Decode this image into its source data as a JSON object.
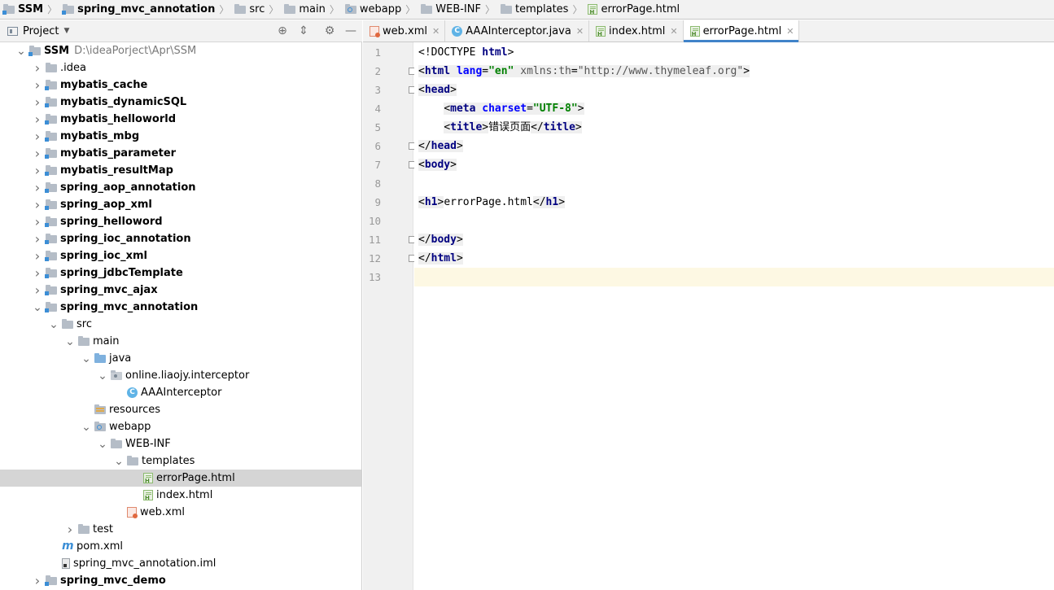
{
  "breadcrumb": [
    {
      "label": "SSM",
      "icon": "module-folder-icon",
      "bold": true
    },
    {
      "label": "spring_mvc_annotation",
      "icon": "module-folder-icon",
      "bold": true
    },
    {
      "label": "src",
      "icon": "folder-icon"
    },
    {
      "label": "main",
      "icon": "folder-icon"
    },
    {
      "label": "webapp",
      "icon": "web-folder-icon"
    },
    {
      "label": "WEB-INF",
      "icon": "folder-icon"
    },
    {
      "label": "templates",
      "icon": "folder-icon"
    },
    {
      "label": "errorPage.html",
      "icon": "html-file-icon"
    }
  ],
  "project_panel": {
    "title": "Project",
    "tree": [
      {
        "depth": 0,
        "arrow": "down",
        "icon": "module-folder-icon",
        "label": "SSM",
        "bold": true,
        "path": "D:\\ideaPorject\\Apr\\SSM"
      },
      {
        "depth": 1,
        "arrow": "right",
        "icon": "folder-icon",
        "label": ".idea"
      },
      {
        "depth": 1,
        "arrow": "right",
        "icon": "module-folder-icon",
        "label": "mybatis_cache",
        "bold": true
      },
      {
        "depth": 1,
        "arrow": "right",
        "icon": "module-folder-icon",
        "label": "mybatis_dynamicSQL",
        "bold": true
      },
      {
        "depth": 1,
        "arrow": "right",
        "icon": "module-folder-icon",
        "label": "mybatis_helloworld",
        "bold": true
      },
      {
        "depth": 1,
        "arrow": "right",
        "icon": "module-folder-icon",
        "label": "mybatis_mbg",
        "bold": true
      },
      {
        "depth": 1,
        "arrow": "right",
        "icon": "module-folder-icon",
        "label": "mybatis_parameter",
        "bold": true
      },
      {
        "depth": 1,
        "arrow": "right",
        "icon": "module-folder-icon",
        "label": "mybatis_resultMap",
        "bold": true
      },
      {
        "depth": 1,
        "arrow": "right",
        "icon": "module-folder-icon",
        "label": "spring_aop_annotation",
        "bold": true
      },
      {
        "depth": 1,
        "arrow": "right",
        "icon": "module-folder-icon",
        "label": "spring_aop_xml",
        "bold": true
      },
      {
        "depth": 1,
        "arrow": "right",
        "icon": "module-folder-icon",
        "label": "spring_helloword",
        "bold": true
      },
      {
        "depth": 1,
        "arrow": "right",
        "icon": "module-folder-icon",
        "label": "spring_ioc_annotation",
        "bold": true
      },
      {
        "depth": 1,
        "arrow": "right",
        "icon": "module-folder-icon",
        "label": "spring_ioc_xml",
        "bold": true
      },
      {
        "depth": 1,
        "arrow": "right",
        "icon": "module-folder-icon",
        "label": "spring_jdbcTemplate",
        "bold": true
      },
      {
        "depth": 1,
        "arrow": "right",
        "icon": "module-folder-icon",
        "label": "spring_mvc_ajax",
        "bold": true
      },
      {
        "depth": 1,
        "arrow": "down",
        "icon": "module-folder-icon",
        "label": "spring_mvc_annotation",
        "bold": true
      },
      {
        "depth": 2,
        "arrow": "down",
        "icon": "folder-icon",
        "label": "src"
      },
      {
        "depth": 3,
        "arrow": "down",
        "icon": "folder-icon",
        "label": "main"
      },
      {
        "depth": 4,
        "arrow": "down",
        "icon": "source-folder-icon",
        "label": "java"
      },
      {
        "depth": 5,
        "arrow": "down",
        "icon": "package-icon",
        "label": "online.liaojy.interceptor"
      },
      {
        "depth": 6,
        "arrow": "none",
        "icon": "class-icon",
        "label": "AAAInterceptor"
      },
      {
        "depth": 4,
        "arrow": "none",
        "icon": "resources-folder-icon",
        "label": "resources"
      },
      {
        "depth": 4,
        "arrow": "down",
        "icon": "web-folder-icon",
        "label": "webapp"
      },
      {
        "depth": 5,
        "arrow": "down",
        "icon": "folder-icon",
        "label": "WEB-INF"
      },
      {
        "depth": 6,
        "arrow": "down",
        "icon": "folder-icon",
        "label": "templates"
      },
      {
        "depth": 7,
        "arrow": "none",
        "icon": "html-file-icon",
        "label": "errorPage.html",
        "selected": true
      },
      {
        "depth": 7,
        "arrow": "none",
        "icon": "html-file-icon",
        "label": "index.html"
      },
      {
        "depth": 6,
        "arrow": "none",
        "icon": "xml-file-icon",
        "label": "web.xml"
      },
      {
        "depth": 3,
        "arrow": "right",
        "icon": "folder-icon",
        "label": "test"
      },
      {
        "depth": 2,
        "arrow": "none",
        "icon": "maven-icon",
        "label": "pom.xml"
      },
      {
        "depth": 2,
        "arrow": "none",
        "icon": "iml-file-icon",
        "label": "spring_mvc_annotation.iml"
      },
      {
        "depth": 1,
        "arrow": "right",
        "icon": "module-folder-icon",
        "label": "spring_mvc_demo",
        "bold": true
      }
    ]
  },
  "tabs": [
    {
      "label": "web.xml",
      "icon": "xml-file-icon"
    },
    {
      "label": "AAAInterceptor.java",
      "icon": "class-icon"
    },
    {
      "label": "index.html",
      "icon": "html-file-icon"
    },
    {
      "label": "errorPage.html",
      "icon": "html-file-icon",
      "active": true
    }
  ],
  "editor": {
    "current_line": 13,
    "lines": [
      [
        {
          "t": "<!DOCTYPE ",
          "c": ""
        },
        {
          "t": "html",
          "c": "tg"
        },
        {
          "t": ">",
          "c": ""
        }
      ],
      [
        {
          "t": "<",
          "c": "hl"
        },
        {
          "t": "html",
          "c": "tg hl"
        },
        {
          "t": " ",
          "c": "hl"
        },
        {
          "t": "lang",
          "c": "at hl"
        },
        {
          "t": "=",
          "c": "hl"
        },
        {
          "t": "\"en\"",
          "c": "st hl"
        },
        {
          "t": " ",
          "c": "hl"
        },
        {
          "t": "xmlns:th",
          "c": "gr hl"
        },
        {
          "t": "=",
          "c": "hl"
        },
        {
          "t": "\"http://www.thymeleaf.org\"",
          "c": "gr hl"
        },
        {
          "t": ">",
          "c": "hl"
        }
      ],
      [
        {
          "t": "<",
          "c": "hl"
        },
        {
          "t": "head",
          "c": "tg hl"
        },
        {
          "t": ">",
          "c": "hl"
        }
      ],
      [
        {
          "t": "    ",
          "c": ""
        },
        {
          "t": "<",
          "c": "hl"
        },
        {
          "t": "meta",
          "c": "tg hl"
        },
        {
          "t": " ",
          "c": "hl"
        },
        {
          "t": "charset",
          "c": "at hl"
        },
        {
          "t": "=",
          "c": "hl"
        },
        {
          "t": "\"UTF-8\"",
          "c": "st hl"
        },
        {
          "t": ">",
          "c": "hl"
        }
      ],
      [
        {
          "t": "    ",
          "c": ""
        },
        {
          "t": "<",
          "c": "hl"
        },
        {
          "t": "title",
          "c": "tg hl"
        },
        {
          "t": ">",
          "c": "hl"
        },
        {
          "t": "错误页面",
          "c": ""
        },
        {
          "t": "</",
          "c": "hl"
        },
        {
          "t": "title",
          "c": "tg hl"
        },
        {
          "t": ">",
          "c": "hl"
        }
      ],
      [
        {
          "t": "</",
          "c": "hl"
        },
        {
          "t": "head",
          "c": "tg hl"
        },
        {
          "t": ">",
          "c": "hl"
        }
      ],
      [
        {
          "t": "<",
          "c": "hl"
        },
        {
          "t": "body",
          "c": "tg hl"
        },
        {
          "t": ">",
          "c": "hl"
        }
      ],
      [],
      [
        {
          "t": "<",
          "c": "hl"
        },
        {
          "t": "h1",
          "c": "tg hl"
        },
        {
          "t": ">",
          "c": "hl"
        },
        {
          "t": "errorPage.html",
          "c": ""
        },
        {
          "t": "</",
          "c": "hl"
        },
        {
          "t": "h1",
          "c": "tg hl"
        },
        {
          "t": ">",
          "c": "hl"
        }
      ],
      [],
      [
        {
          "t": "</",
          "c": "hl"
        },
        {
          "t": "body",
          "c": "tg hl"
        },
        {
          "t": ">",
          "c": "hl"
        }
      ],
      [
        {
          "t": "</",
          "c": "hl"
        },
        {
          "t": "html",
          "c": "tg hl"
        },
        {
          "t": ">",
          "c": "hl"
        }
      ],
      []
    ],
    "fold_lines": [
      2,
      3,
      6,
      7,
      11,
      12
    ]
  }
}
